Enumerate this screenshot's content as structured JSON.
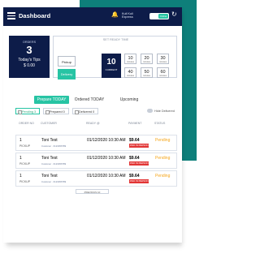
{
  "header": {
    "title": "Dashboard",
    "store_line1": "Kuli Kuli",
    "store_line2": "Express",
    "toggle_label": "Online"
  },
  "orders_card": {
    "label": "ORDERS",
    "count": "3",
    "tips_label": "Today's Tips",
    "tips_amount": "$ 0.00"
  },
  "ready_time": {
    "title": "SET READY TIME",
    "pickup_label": "Pickup",
    "delivery_label": "Delivery",
    "current_value": "10",
    "current_unit": "CURRENT",
    "options": [
      {
        "value": "10",
        "unit": "minutes"
      },
      {
        "value": "20",
        "unit": "minutes"
      },
      {
        "value": "30",
        "unit": "minutes"
      },
      {
        "value": "40",
        "unit": "minutes"
      },
      {
        "value": "50",
        "unit": "minutes"
      },
      {
        "value": "60",
        "unit": "minutes"
      }
    ]
  },
  "tabs": [
    {
      "label": "Prepare TODAY",
      "active": true
    },
    {
      "label": "Ordered TODAY",
      "active": false
    },
    {
      "label": "Upcoming",
      "active": false
    }
  ],
  "filters": [
    {
      "label": "Pending 3",
      "checked": true
    },
    {
      "label": "Prepared 0",
      "checked": false
    },
    {
      "label": "Delivered 0",
      "checked": false
    }
  ],
  "hide_delivered_label": "Hide Delivered",
  "table": {
    "columns": [
      "ORDER NO",
      "CUSTOMER",
      "READY @",
      "PAYMENT",
      "STATUS"
    ],
    "rows": [
      {
        "qty": "1",
        "type": "PICKUP",
        "customer": "Toni Test",
        "meta": "Customer · 0123456789",
        "ready": "01/12/2020 10:30 AM",
        "price": "$9.64",
        "paid": "PAID IN PERSON",
        "status": "Pending"
      },
      {
        "qty": "1",
        "type": "PICKUP",
        "customer": "Toni Test",
        "meta": "Customer · 0123456789",
        "ready": "01/12/2020 10:30 AM",
        "price": "$9.64",
        "paid": "PAID IN PERSON",
        "status": "Pending"
      },
      {
        "qty": "1",
        "type": "PICKUP",
        "customer": "Toni Test",
        "meta": "Customer · 0123456789",
        "ready": "01/12/2020 10:30 AM",
        "price": "$9.64",
        "paid": "PAID IN PERSON",
        "status": "Pending"
      }
    ]
  },
  "more_label": "PREVIOUS 10"
}
